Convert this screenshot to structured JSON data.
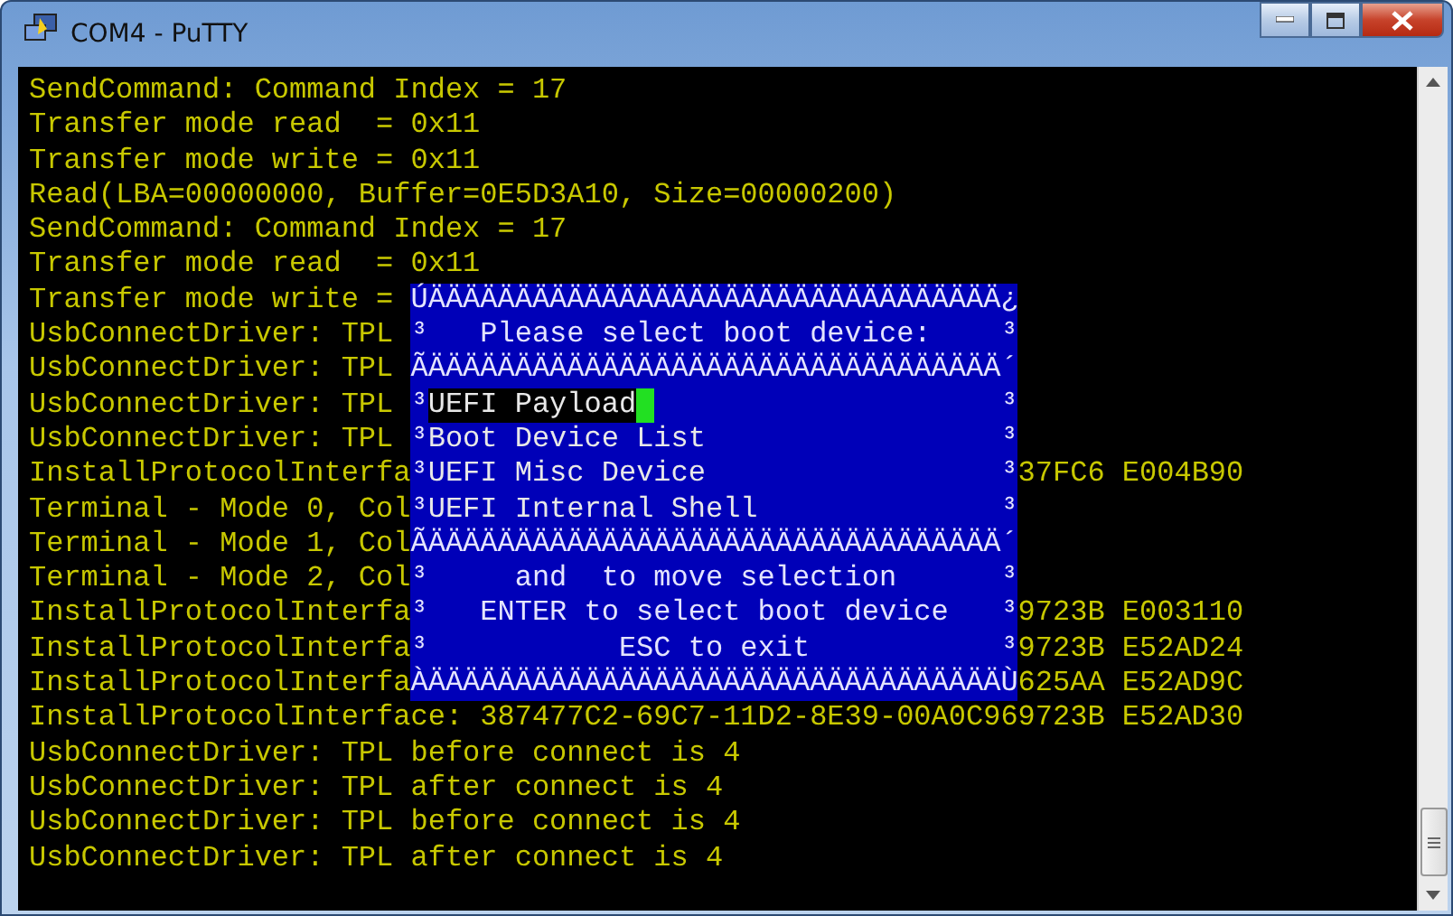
{
  "window": {
    "title": "COM4 - PuTTY"
  },
  "terminal": {
    "lines_above": [
      "SendCommand: Command Index = 17",
      "Transfer mode read  = 0x11",
      "Transfer mode write = 0x11",
      "Read(LBA=00000000, Buffer=0E5D3A10, Size=00000200)",
      "SendCommand: Command Index = 17",
      "Transfer mode read  = 0x11"
    ],
    "middle_rows": [
      {
        "left": "Transfer mode write = "
      },
      {
        "left": "UsbConnectDriver: TPL "
      },
      {
        "left": "UsbConnectDriver: TPL "
      },
      {
        "left": "UsbConnectDriver: TPL "
      },
      {
        "left": "UsbConnectDriver: TPL "
      },
      {
        "left": "InstallProtocolInterfa",
        "right": "37FC6 E004B90"
      },
      {
        "left": "Terminal - Mode 0, Col"
      },
      {
        "left": "Terminal - Mode 1, Col"
      },
      {
        "left": "Terminal - Mode 2, Col"
      },
      {
        "left": "InstallProtocolInterfa",
        "right": "9723B E003110"
      },
      {
        "left": "InstallProtocolInterfa",
        "right": "9723B E52AD24"
      },
      {
        "left": "InstallProtocolInterfa",
        "right": "625AA E52AD9C"
      }
    ],
    "dialog": [
      {
        "kind": "border",
        "text": "ÚÄÄÄÄÄÄÄÄÄÄÄÄÄÄÄÄÄÄÄÄÄÄÄÄÄÄÄÄÄÄÄÄÄ¿"
      },
      {
        "kind": "text",
        "text": "³   Please select boot device:    ³"
      },
      {
        "kind": "border",
        "text": "ÃÄÄÄÄÄÄÄÄÄÄÄÄÄÄÄÄÄÄÄÄÄÄÄÄÄÄÄÄÄÄÄÄÄ´"
      },
      {
        "kind": "item",
        "left": "³",
        "label": "UEFI Payload",
        "right": "³",
        "selected": true
      },
      {
        "kind": "item",
        "left": "³",
        "label": "Boot Device List",
        "right": "³",
        "selected": false
      },
      {
        "kind": "item",
        "left": "³",
        "label": "UEFI Misc Device",
        "right": "³",
        "selected": false
      },
      {
        "kind": "item",
        "left": "³",
        "label": "UEFI Internal Shell",
        "right": "³",
        "selected": false
      },
      {
        "kind": "border",
        "text": "ÃÄÄÄÄÄÄÄÄÄÄÄÄÄÄÄÄÄÄÄÄÄÄÄÄÄÄÄÄÄÄÄÄÄ´"
      },
      {
        "kind": "text",
        "text": "³     and  to move selection      ³"
      },
      {
        "kind": "text",
        "text": "³   ENTER to select boot device   ³"
      },
      {
        "kind": "text",
        "text": "³           ESC to exit           ³"
      },
      {
        "kind": "border",
        "text": "ÀÄÄÄÄÄÄÄÄÄÄÄÄÄÄÄÄÄÄÄÄÄÄÄÄÄÄÄÄÄÄÄÄÄÙ"
      }
    ],
    "lines_below": [
      "InstallProtocolInterface: 387477C2-69C7-11D2-8E39-00A0C969723B E52AD30",
      "UsbConnectDriver: TPL before connect is 4",
      "UsbConnectDriver: TPL after connect is 4",
      "UsbConnectDriver: TPL before connect is 4",
      "UsbConnectDriver: TPL after connect is 4"
    ]
  }
}
